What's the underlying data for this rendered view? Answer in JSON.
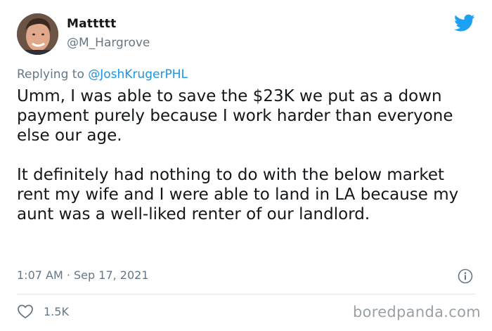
{
  "user": {
    "display_name": "Mattttt",
    "handle": "@M_Hargrove"
  },
  "reply": {
    "prefix": "Replying to ",
    "mention": "@JoshKrugerPHL"
  },
  "tweet": {
    "paragraph_1": "Umm, I was able to save the $23K we put as a down payment purely because I work harder than everyone else our age.",
    "paragraph_2": "It definitely had nothing to do with the below market rent my wife and I were able to land in LA because my aunt was a well-liked renter of our landlord.",
    "timestamp": "1:07 AM · Sep 17, 2021"
  },
  "engagement": {
    "likes": "1.5K"
  },
  "watermark": "boredpanda.com",
  "icons": {
    "brand": "twitter-bird-icon",
    "info": "info-icon",
    "like": "heart-icon"
  },
  "colors": {
    "twitter_blue": "#1da1f2",
    "link_blue": "#1b95e0",
    "secondary_text": "#657786",
    "primary_text": "#14171a",
    "divider": "#e1e8ed"
  }
}
